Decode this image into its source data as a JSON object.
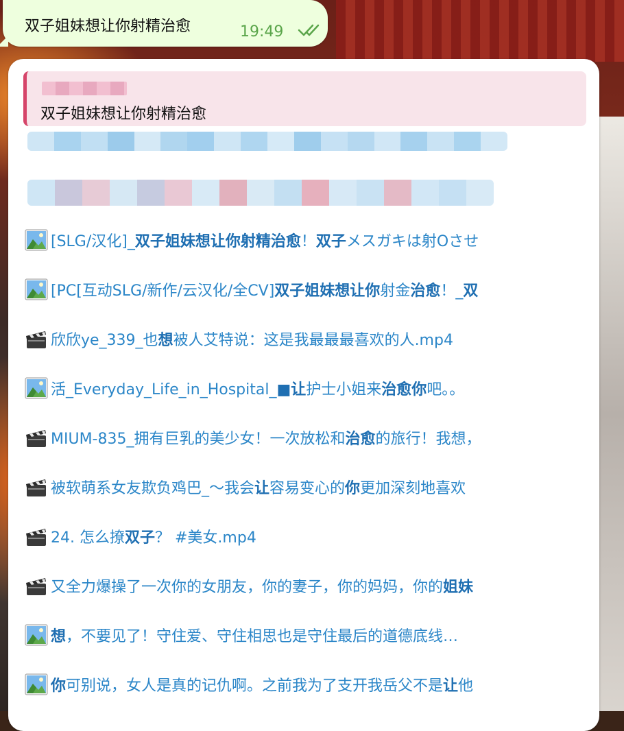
{
  "outgoing": {
    "text": "双子姐妹想让你射精治愈",
    "time": "19:49",
    "status_icon": "double-check-icon"
  },
  "reply": {
    "quote_text": "双子姐妹想让你射精治愈"
  },
  "results": [
    {
      "icon": "image-icon",
      "parts": [
        [
          "[SLG/汉化]_",
          false
        ],
        [
          "双子姐妹想让你射精治愈",
          true
        ],
        [
          "！",
          false
        ],
        [
          "双子",
          true
        ],
        [
          "メスガキは射Oさせ",
          false
        ]
      ]
    },
    {
      "icon": "image-icon",
      "parts": [
        [
          "[PC[互动SLG/新作/云汉化/全CV]",
          false
        ],
        [
          "双子姐妹想让你",
          true
        ],
        [
          "射金",
          false
        ],
        [
          "治愈",
          true
        ],
        [
          "！_",
          false
        ],
        [
          "双",
          true
        ]
      ]
    },
    {
      "icon": "video-icon",
      "parts": [
        [
          "欣欣ye_339_也",
          false
        ],
        [
          "想",
          true
        ],
        [
          "被人艾特说：这是我最最最喜欢的人.mp4",
          false
        ]
      ]
    },
    {
      "icon": "image-icon",
      "parts": [
        [
          "活_Everyday_Life_in_Hospital_",
          false
        ],
        [
          "■让",
          true
        ],
        [
          "护士小姐来",
          false
        ],
        [
          "治愈你",
          true
        ],
        [
          "吧。。",
          false
        ]
      ]
    },
    {
      "icon": "video-icon",
      "parts": [
        [
          "MIUM-835_拥有巨乳的美少女！一次放松和",
          false
        ],
        [
          "治愈",
          true
        ],
        [
          "的旅行！我想，",
          false
        ]
      ]
    },
    {
      "icon": "video-icon",
      "parts": [
        [
          "被软萌系女友欺负鸡巴_～我会",
          false
        ],
        [
          "让",
          true
        ],
        [
          "容易变心的",
          false
        ],
        [
          "你",
          true
        ],
        [
          "更加深刻地喜欢",
          false
        ]
      ]
    },
    {
      "icon": "video-icon",
      "parts": [
        [
          "24. 怎么撩",
          false
        ],
        [
          "双子",
          true
        ],
        [
          "？ #美女.mp4",
          false
        ]
      ]
    },
    {
      "icon": "video-icon",
      "parts": [
        [
          "又全力爆操了一次你的女朋友，你的妻子，你的妈妈，你的",
          false
        ],
        [
          "姐妹",
          true
        ]
      ]
    },
    {
      "icon": "image-icon",
      "parts": [
        [
          "想",
          true
        ],
        [
          "，不要见了！守住爱、守住相思也是守住最后的道德底线…",
          false
        ]
      ]
    },
    {
      "icon": "image-icon",
      "parts": [
        [
          "你",
          true
        ],
        [
          "可别说，女人是真的记仇啊。之前我为了支开我岳父不是",
          false
        ],
        [
          "让",
          true
        ],
        [
          "他",
          false
        ]
      ]
    }
  ],
  "colors": {
    "outgoing_bubble": "#eeffde",
    "time_green": "#5aa54a",
    "quote_bg": "#f8e4ea",
    "quote_bar": "#d6456a",
    "link_blue": "#2b86c8"
  }
}
